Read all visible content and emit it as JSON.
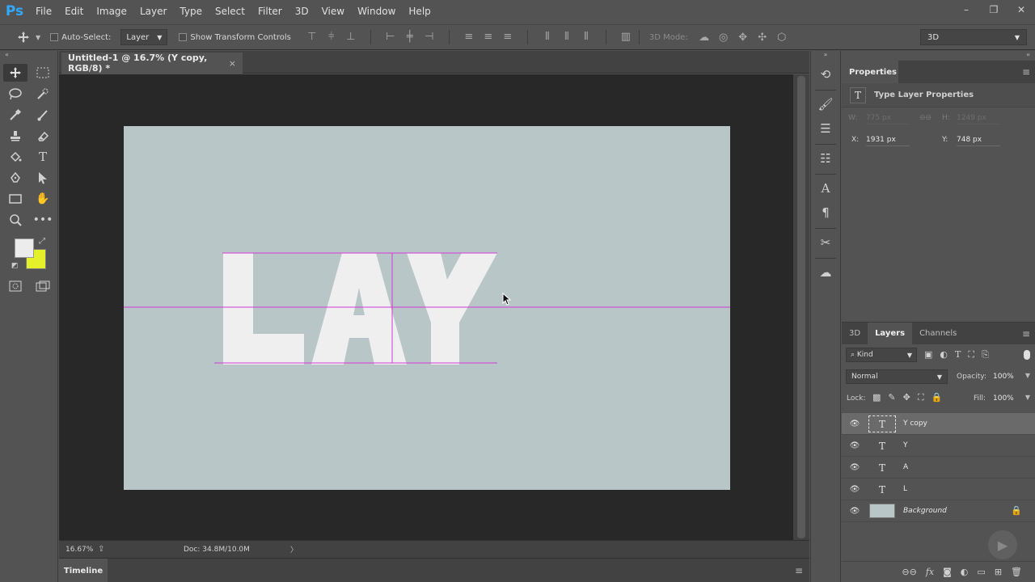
{
  "app": {
    "logo": "Ps"
  },
  "menu": [
    "File",
    "Edit",
    "Image",
    "Layer",
    "Type",
    "Select",
    "Filter",
    "3D",
    "View",
    "Window",
    "Help"
  ],
  "window_controls": {
    "minimize": "–",
    "restore": "❐",
    "close": "✕"
  },
  "options_bar": {
    "auto_select_label": "Auto-Select:",
    "auto_select_target": "Layer",
    "show_transform_label": "Show Transform Controls",
    "mode_3d_label": "3D Mode:",
    "workspace": "3D"
  },
  "document": {
    "tab_title": "Untitled-1 @ 16.7% (Y copy, RGB/8) *",
    "close": "×",
    "canvas_color": "#b9c6c8",
    "text_color": "#efefef",
    "guide_color": "#d23bd6",
    "letters": [
      "L",
      "A",
      "Y"
    ]
  },
  "status": {
    "zoom": "16.67%",
    "doc": "Doc: 34.8M/10.0M",
    "arrow": "〉"
  },
  "timeline": {
    "label": "Timeline"
  },
  "colors": {
    "foreground": "#ececec",
    "background": "#e3f02a",
    "accent": "#31a8ff"
  },
  "properties": {
    "tab": "Properties",
    "type_title": "Type Layer Properties",
    "w_label": "W:",
    "w_value": "775 px",
    "h_label": "H:",
    "h_value": "1249 px",
    "x_label": "X:",
    "x_value": "1931 px",
    "y_label": "Y:",
    "y_value": "748 px"
  },
  "layers_panel": {
    "tabs": [
      "3D",
      "Layers",
      "Channels"
    ],
    "active_tab": "Layers",
    "kind": "Kind",
    "blend_mode": "Normal",
    "opacity_label": "Opacity:",
    "opacity": "100%",
    "lock_label": "Lock:",
    "fill_label": "Fill:",
    "fill": "100%",
    "layers": [
      {
        "name": "Y copy",
        "type": "text",
        "selected": true
      },
      {
        "name": "Y",
        "type": "text",
        "selected": false
      },
      {
        "name": "A",
        "type": "text",
        "selected": false
      },
      {
        "name": "L",
        "type": "text",
        "selected": false
      },
      {
        "name": "Background",
        "type": "image",
        "selected": false,
        "locked": true
      }
    ]
  }
}
